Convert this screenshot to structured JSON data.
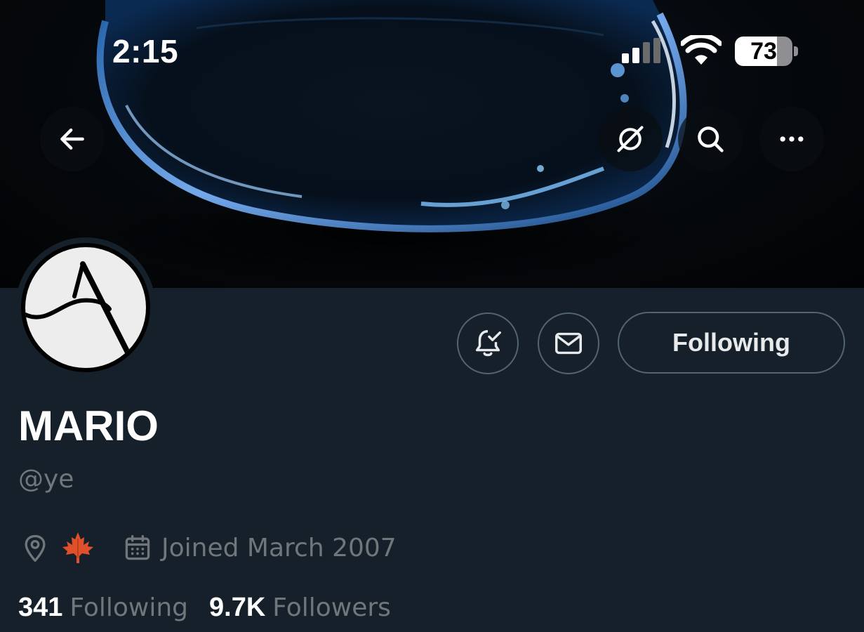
{
  "status_bar": {
    "time": "2:15",
    "battery_level": "73"
  },
  "nav": {
    "back_icon": "arrow-left-icon",
    "grok_icon": "grok-icon",
    "search_icon": "search-icon",
    "more_icon": "more-horizontal-icon"
  },
  "profile": {
    "display_name": "MARIO",
    "handle": "@ye",
    "location_flag": "🍁",
    "joined": "Joined March 2007",
    "following_count": "341",
    "following_label": "Following",
    "followers_count": "9.7K",
    "followers_label": "Followers"
  },
  "actions": {
    "notify_icon": "bell-check-icon",
    "message_icon": "envelope-icon",
    "follow_state_label": "Following"
  },
  "colors": {
    "background": "#15202b",
    "secondary_text": "#71767b",
    "border": "#536471",
    "primary_text": "#ffffff"
  }
}
